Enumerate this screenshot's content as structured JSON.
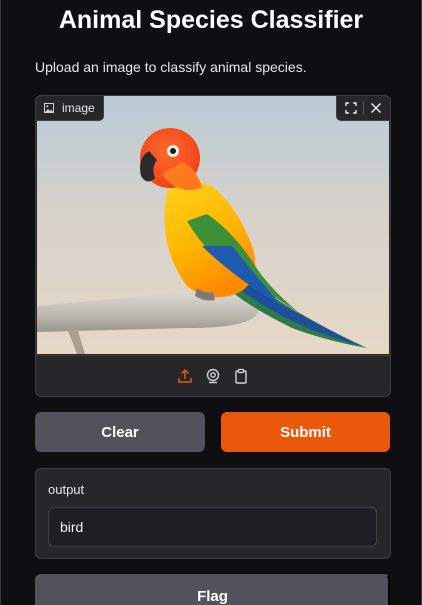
{
  "app": {
    "title": "Animal Species Classifier",
    "description": "Upload an image to classify animal species."
  },
  "image_input": {
    "label": "image",
    "label_icon": "image-icon",
    "corner_tools": [
      "fullscreen-icon",
      "close-icon"
    ],
    "sources": [
      "upload-icon",
      "webcam-icon",
      "clipboard-icon"
    ],
    "active_source": "upload-icon",
    "photo_subject": "parrot-photo"
  },
  "buttons": {
    "clear": "Clear",
    "submit": "Submit",
    "flag": "Flag"
  },
  "output": {
    "label": "output",
    "value": "bird"
  },
  "colors": {
    "accent": "#ea580c",
    "secondary_button": "#52525b",
    "panel": "#27272a",
    "background": "#0f0f11"
  }
}
